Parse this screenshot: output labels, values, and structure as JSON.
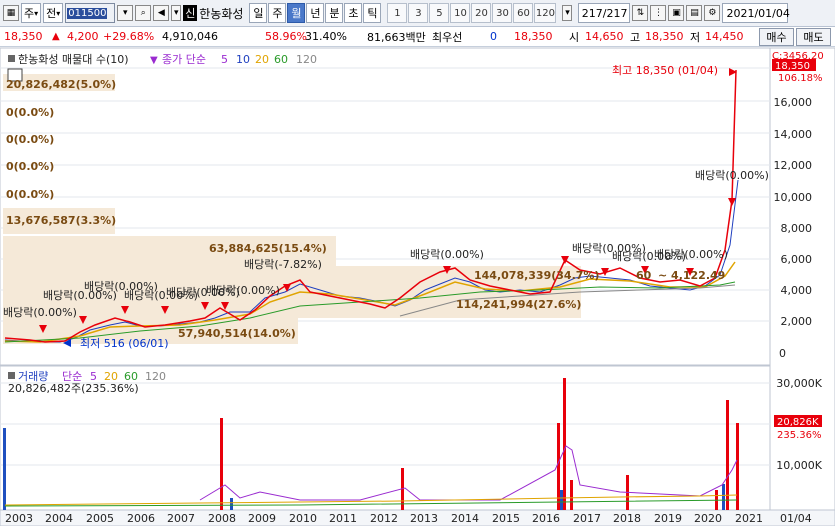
{
  "toolbar": {
    "type_label": "주",
    "market_label": "전",
    "stock_code": "011500",
    "sin_badge": "신",
    "stock_name": "한농화성",
    "periods": [
      "일",
      "주",
      "월",
      "년",
      "분",
      "초",
      "틱"
    ],
    "active_period": "월",
    "intervals": [
      "1",
      "3",
      "5",
      "10",
      "20",
      "30",
      "60",
      "120"
    ],
    "counter": "217/217",
    "date": "2021/01/04"
  },
  "quote": {
    "price": "18,350",
    "change": "4,200",
    "change_pct": "+29.68%",
    "volume": "4,910,046",
    "volume_ratio": "58.96%",
    "turnover": "31.40%",
    "amount": "81,663백만",
    "best_bid_label": "최우선",
    "best_bid_value": "0",
    "close": "18,350",
    "open_label": "시",
    "open": "14,650",
    "high_label": "고",
    "high": "18,350",
    "low_label": "저",
    "low": "14,450",
    "buy_label": "매수",
    "sell_label": "매도"
  },
  "colors": {
    "up": "#e8000b",
    "down": "#0033cc",
    "ma5": "#9a2bd0",
    "ma10": "#1f3fbf",
    "ma20": "#e0a400",
    "ma60": "#2a9b2a",
    "ma120": "#888888"
  },
  "price_panel": {
    "header_name": "한농화성 매물대 수(10)",
    "ma_label": "종가 단순",
    "ma_periods": [
      "5",
      "10",
      "20",
      "60",
      "120"
    ],
    "axis_top": "C:3456.20",
    "current_price_tag": "18,350",
    "current_pct_tag": "106.18%",
    "y_ticks": [
      "18,000",
      "16,000",
      "14,000",
      "12,000",
      "10,000",
      "8,000",
      "6,000",
      "4,000",
      "2,000",
      "0"
    ],
    "volume_profile_labels": [
      "20,826,482(5.0%)",
      "0(0.0%)",
      "0(0.0%)",
      "0(0.0%)",
      "0(0.0%)",
      "13,676,587(3.3%)",
      "63,884,625(15.4%)",
      "144,078,339(34.7%)",
      "114,241,994(27.6%)",
      "57,940,514(14.0%)"
    ],
    "high_marker": "최고 18,350 (01/04)",
    "low_marker": "최저 516 (06/01)",
    "dividend_labels": [
      "배당락(0.00%)",
      "배당락(0.00%)",
      "배당락(0.00%)",
      "배당락(0.00%)",
      "배당락(0.00%)",
      "배당락(0.00%)",
      "배당락(-7.82%)",
      "배당락(0.00%)",
      "배당락(0.00%)",
      "배당락(0.00%)",
      "배당락(0.00%)",
      "배당락(0.00%)"
    ],
    "trend_label": "~ 4,122.49",
    "trend_prefix": "60"
  },
  "volume_panel": {
    "header_name": "거래량",
    "ma_label": "단순",
    "ma_periods": [
      "5",
      "20",
      "60",
      "120"
    ],
    "value_label": "20,826,482주(235.36%)",
    "y_ticks": [
      "30,000K",
      "20,000K",
      "10,000K"
    ],
    "current_tag": "20,826K",
    "current_pct_tag": "235.36%"
  },
  "x_axis": {
    "labels": [
      "2003",
      "2004",
      "2005",
      "2006",
      "2007",
      "2008",
      "2009",
      "2010",
      "2011",
      "2012",
      "2013",
      "2014",
      "2015",
      "2016",
      "2017",
      "2018",
      "2019",
      "2020",
      "2021"
    ],
    "end_label": "01/04"
  }
}
